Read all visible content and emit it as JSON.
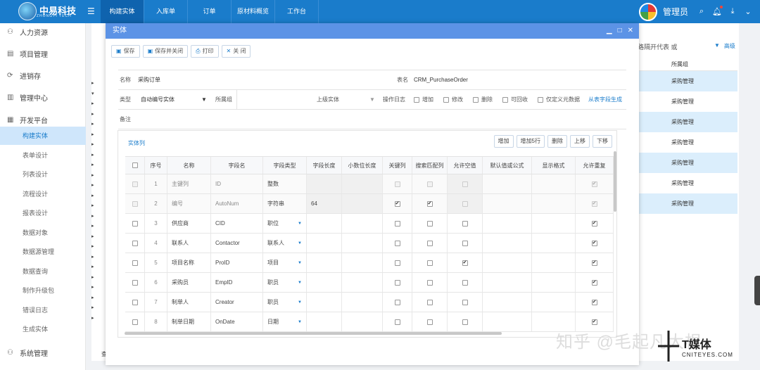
{
  "header": {
    "logo_title": "中易科技",
    "logo_sub": "ZHONGYI TECH",
    "nav": [
      "构建实体",
      "入库单",
      "订单",
      "原材料概览",
      "工作台"
    ],
    "active_nav": 0,
    "user": "管理员"
  },
  "sidebar": {
    "groups": [
      {
        "label": "人力资源",
        "icon": "person-icon"
      },
      {
        "label": "项目管理",
        "icon": "calendar-icon"
      },
      {
        "label": "进销存",
        "icon": "cycle-icon"
      },
      {
        "label": "管理中心",
        "icon": "chart-icon"
      },
      {
        "label": "开发平台",
        "icon": "doc-icon"
      }
    ],
    "sub_items": [
      "构建实体",
      "表单设计",
      "列表设计",
      "流程设计",
      "报表设计",
      "数据对象",
      "数据源管理",
      "数据查询",
      "制作升级包",
      "错误日志",
      "生成实体"
    ],
    "active_sub": 0,
    "bottom": {
      "label": "系统管理",
      "icon": "people-icon"
    }
  },
  "background": {
    "right_text": "路隔开代表 或",
    "advanced": "高级",
    "col_header": "所属组",
    "rows": [
      "采购管理",
      "采购管理",
      "采购管理",
      "采购管理",
      "采购管理",
      "采购管理",
      "采购管理"
    ],
    "bottom_left": "查询方案"
  },
  "modal": {
    "title": "实体",
    "toolbar": {
      "save": "保存",
      "save_close": "保存并关闭",
      "print": "打印",
      "close": "关 闭"
    },
    "form": {
      "name_label": "名称",
      "name_value": "采购订单",
      "table_label": "表名",
      "table_value": "CRM_PurchaseOrder",
      "type_label": "类型",
      "type_value": "自动编号实体",
      "group_label": "所属组",
      "parent_label": "上级实体",
      "log_label": "操作日志",
      "checks": [
        "增加",
        "修改",
        "删除",
        "可回收",
        "仅定义元数据"
      ],
      "gen_link": "从表字段生成",
      "remark_label": "备注"
    },
    "panel": {
      "title": "实体列",
      "buttons": [
        "增加",
        "增加5行",
        "删除",
        "上移",
        "下移"
      ],
      "columns": [
        "序号",
        "名称",
        "字段名",
        "字段类型",
        "字段长度",
        "小数位长度",
        "关键列",
        "搜索匹配列",
        "允许空值",
        "默认值或公式",
        "显示格式",
        "允许重复"
      ],
      "rows": [
        {
          "no": "1",
          "name": "主键列",
          "field": "ID",
          "type": "整数",
          "len": "",
          "key": false,
          "search": false,
          "null": false,
          "dup": true,
          "disabled": true
        },
        {
          "no": "2",
          "name": "编号",
          "field": "AutoNum",
          "type": "字符串",
          "len": "64",
          "key": true,
          "search": true,
          "null": false,
          "dup": true,
          "disabled": true
        },
        {
          "no": "3",
          "name": "供应商",
          "field": "CID",
          "type": "职位",
          "len": "",
          "key": false,
          "search": false,
          "null": false,
          "dup": true,
          "disabled": false
        },
        {
          "no": "4",
          "name": "联系人",
          "field": "Contactor",
          "type": "联系人",
          "len": "",
          "key": false,
          "search": false,
          "null": false,
          "dup": true,
          "disabled": false
        },
        {
          "no": "5",
          "name": "项目名称",
          "field": "ProID",
          "type": "项目",
          "len": "",
          "key": false,
          "search": false,
          "null": true,
          "dup": true,
          "disabled": false
        },
        {
          "no": "6",
          "name": "采购员",
          "field": "EmpID",
          "type": "职员",
          "len": "",
          "key": false,
          "search": false,
          "null": false,
          "dup": true,
          "disabled": false
        },
        {
          "no": "7",
          "name": "制单人",
          "field": "Creator",
          "type": "职员",
          "len": "",
          "key": false,
          "search": false,
          "null": false,
          "dup": true,
          "disabled": false
        },
        {
          "no": "8",
          "name": "制单日期",
          "field": "OnDate",
          "type": "日期",
          "len": "",
          "key": false,
          "search": false,
          "null": false,
          "dup": true,
          "disabled": false
        }
      ]
    }
  },
  "watermark": {
    "text": "知乎 @毛起凡大根",
    "brand": "T媒体",
    "brand_url": "CNITEYES.COM"
  }
}
